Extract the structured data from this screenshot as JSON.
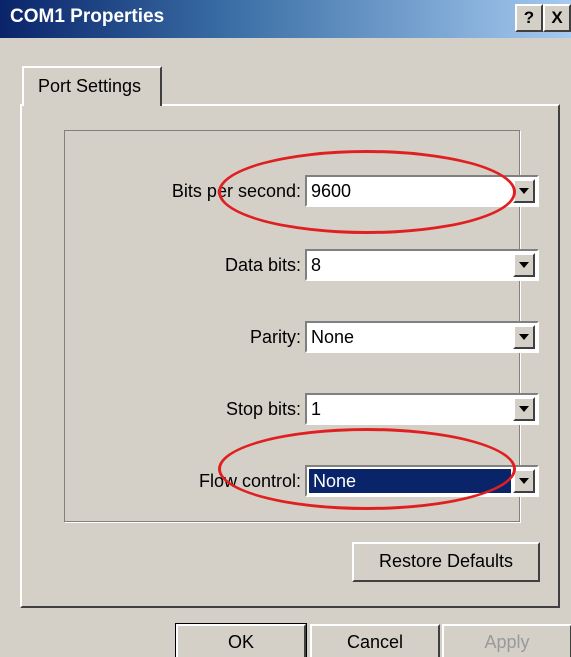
{
  "window": {
    "title": "COM1 Properties",
    "help_label": "?",
    "close_label": "X"
  },
  "tabs": [
    {
      "label": "Port Settings",
      "active": true
    }
  ],
  "fields": {
    "bits_per_second": {
      "label": "Bits per second:",
      "value": "9600"
    },
    "data_bits": {
      "label": "Data bits:",
      "value": "8"
    },
    "parity": {
      "label": "Parity:",
      "value": "None"
    },
    "stop_bits": {
      "label": "Stop bits:",
      "value": "1"
    },
    "flow_control": {
      "label": "Flow control:",
      "value": "None",
      "selected": true
    }
  },
  "buttons": {
    "restore_defaults": "Restore Defaults",
    "ok": "OK",
    "cancel": "Cancel",
    "apply": "Apply"
  },
  "colors": {
    "title_bar": "#0a246a",
    "dialog_face": "#d4d0c8",
    "selection": "#0a246a",
    "annotation": "#e02020"
  }
}
